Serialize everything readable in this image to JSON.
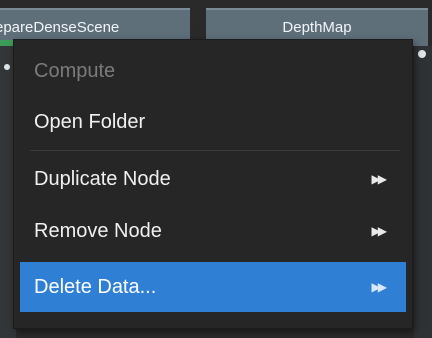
{
  "graph": {
    "nodes": [
      {
        "label": "repareDenseScene"
      },
      {
        "label": "DepthMap"
      }
    ]
  },
  "context_menu": {
    "items": [
      {
        "label": "Compute",
        "enabled": false,
        "submenu": false
      },
      {
        "label": "Open Folder",
        "enabled": true,
        "submenu": false
      },
      {
        "label": "Duplicate Node",
        "enabled": true,
        "submenu": true
      },
      {
        "label": "Remove Node",
        "enabled": true,
        "submenu": true
      },
      {
        "label": "Delete Data...",
        "enabled": true,
        "submenu": true,
        "selected": true
      }
    ],
    "submenu_glyph": "▶▶"
  },
  "colors": {
    "menu_highlight": "#2f7fd4",
    "node_header": "#5e6f7a",
    "node_status_done": "#3d9c58",
    "disabled_text": "#7b7b7b"
  }
}
